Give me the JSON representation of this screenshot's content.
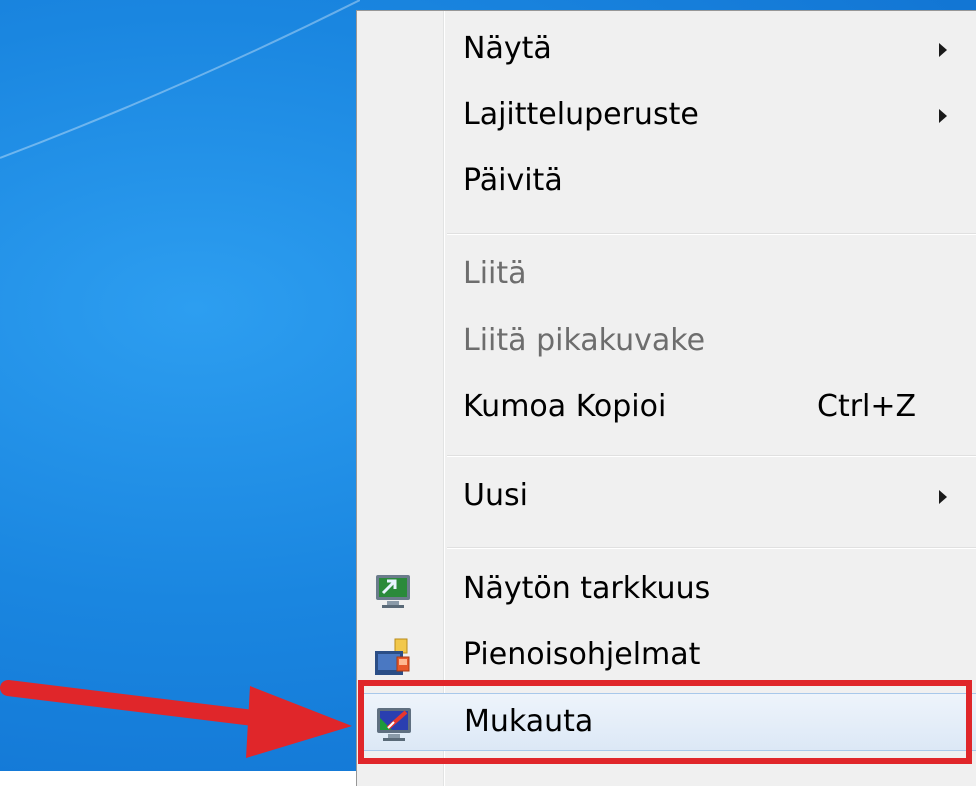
{
  "context_menu": {
    "items": [
      {
        "label": "Näytä",
        "submenu": true,
        "disabled": false
      },
      {
        "label": "Lajitteluperuste",
        "submenu": true,
        "disabled": false
      },
      {
        "label": "Päivitä",
        "submenu": false,
        "disabled": false
      },
      {
        "label": "Liitä",
        "submenu": false,
        "disabled": true
      },
      {
        "label": "Liitä pikakuvake",
        "submenu": false,
        "disabled": true
      },
      {
        "label": "Kumoa Kopioi",
        "shortcut": "Ctrl+Z",
        "submenu": false,
        "disabled": false
      },
      {
        "label": "Uusi",
        "submenu": true,
        "disabled": false
      },
      {
        "label": "Näytön tarkkuus",
        "icon": "screen-resolution-icon",
        "disabled": false
      },
      {
        "label": "Pienoisohjelmat",
        "icon": "gadgets-icon",
        "disabled": false
      },
      {
        "label": "Mukauta",
        "icon": "personalize-icon",
        "disabled": false,
        "highlighted": true
      }
    ]
  },
  "annotation": {
    "highlight_color": "#e0262a",
    "arrow_color": "#e0262a"
  },
  "colors": {
    "desktop_blue": "#1a86e0",
    "menu_bg": "#f0f0f0",
    "disabled_text": "#6d6d6d"
  }
}
